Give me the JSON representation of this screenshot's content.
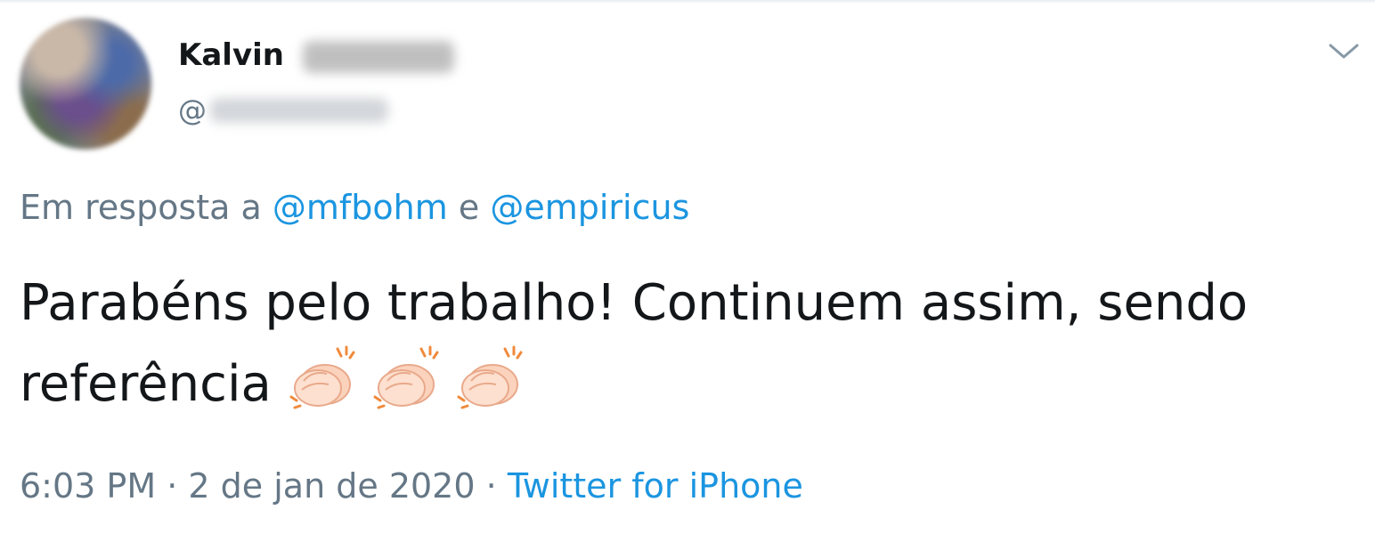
{
  "author": {
    "display_name": "Kalvin",
    "handle_prefix": "@"
  },
  "reply": {
    "prefix": "Em resposta a",
    "mentions": [
      "@mfbohm",
      "@empiricus"
    ],
    "joiner": "e"
  },
  "tweet": {
    "line1": "Parabéns pelo trabalho! Continuem assim, sendo",
    "line2": "referência",
    "emoji": [
      "clapping-hands",
      "clapping-hands",
      "clapping-hands"
    ]
  },
  "meta": {
    "time": "6:03 PM",
    "separator": "·",
    "date": "2 de jan de 2020",
    "source": "Twitter for iPhone"
  },
  "icons": {
    "menu": "chevron-down-icon"
  },
  "colors": {
    "link": "#1b95e0",
    "secondary_text": "#657786",
    "primary_text": "#14171a"
  }
}
